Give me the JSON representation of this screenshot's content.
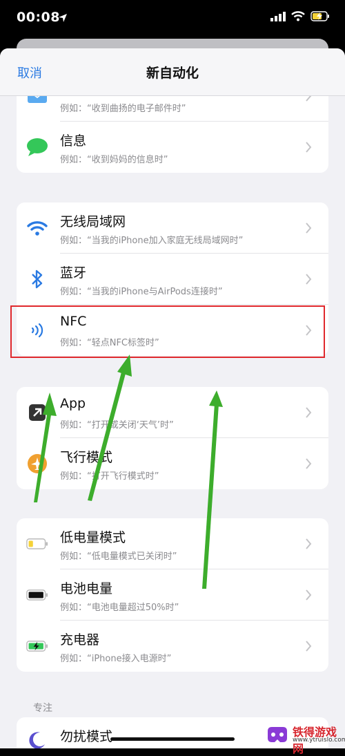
{
  "status_bar": {
    "time": "00:08"
  },
  "nav": {
    "cancel_label": "取消",
    "title": "新自动化"
  },
  "groups": [
    {
      "rows": [
        {
          "icon": "mail-icon",
          "title": "",
          "subtitle": "例如：“收到曲扬的电子邮件时”"
        },
        {
          "icon": "message-icon",
          "title": "信息",
          "subtitle": "例如：“收到妈妈的信息时”"
        }
      ]
    },
    {
      "rows": [
        {
          "icon": "wifi-icon",
          "title": "无线局域网",
          "subtitle": "例如：“当我的iPhone加入家庭无线局域网时”"
        },
        {
          "icon": "bluetooth-icon",
          "title": "蓝牙",
          "subtitle": "例如：“当我的iPhone与AirPods连接时”"
        },
        {
          "icon": "nfc-icon",
          "title": "NFC",
          "subtitle": "例如：“轻点NFC标签时”"
        }
      ]
    },
    {
      "rows": [
        {
          "icon": "app-icon",
          "title": "App",
          "subtitle": "例如：“打开或关闭‘天气’时”"
        },
        {
          "icon": "airplane-mode-icon",
          "title": "飞行模式",
          "subtitle": "例如：“打开飞行模式时”"
        }
      ]
    },
    {
      "rows": [
        {
          "icon": "low-battery-icon",
          "title": "低电量模式",
          "subtitle": "例如：“低电量模式已关闭时”"
        },
        {
          "icon": "battery-level-icon",
          "title": "电池电量",
          "subtitle": "例如：“电池电量超过50%时”"
        },
        {
          "icon": "charger-icon",
          "title": "充电器",
          "subtitle": "例如：“iPhone接入电源时”"
        }
      ]
    },
    {
      "header": "专注",
      "rows": [
        {
          "icon": "moon-icon",
          "title": "勿扰模式",
          "subtitle": ""
        }
      ]
    }
  ],
  "colors": {
    "accent": "#2a7ae2",
    "highlight": "#e0282c",
    "arrow": "#3dad2c"
  },
  "watermark": {
    "name": "铁得游戏网",
    "url": "www.ytruislo.com"
  }
}
